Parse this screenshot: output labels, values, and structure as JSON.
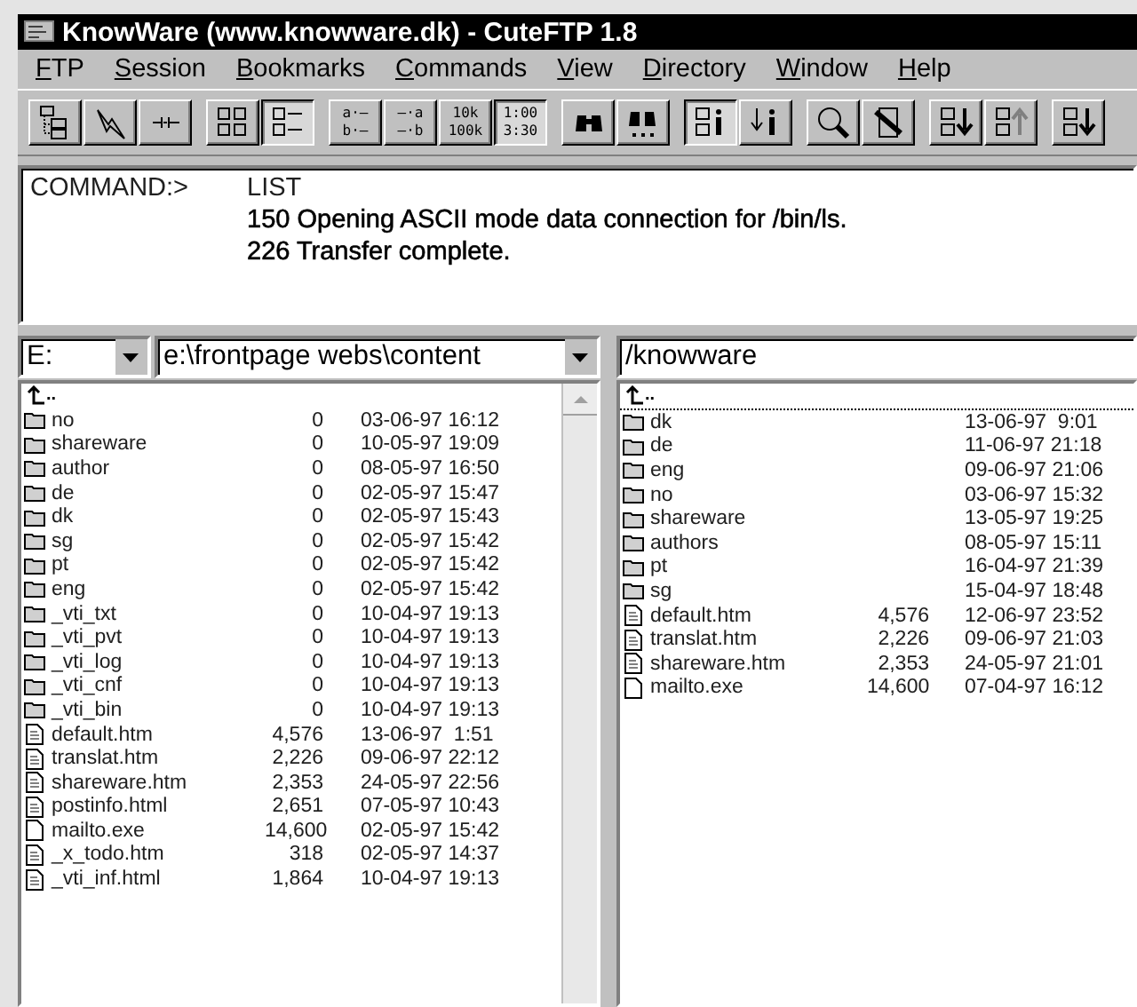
{
  "window": {
    "title": "KnowWare (www.knowware.dk) - CuteFTP 1.8"
  },
  "menu": [
    {
      "access_key": "F",
      "rest": "TP"
    },
    {
      "access_key": "S",
      "rest": "ession"
    },
    {
      "access_key": "B",
      "rest": "ookmarks"
    },
    {
      "access_key": "C",
      "rest": "ommands"
    },
    {
      "access_key": "V",
      "rest": "iew"
    },
    {
      "access_key": "D",
      "rest": "irectory"
    },
    {
      "access_key": "W",
      "rest": "indow"
    },
    {
      "access_key": "H",
      "rest": "elp"
    }
  ],
  "toolbar": [
    [
      {
        "kind": "tree",
        "pressed": false
      },
      {
        "kind": "bolt",
        "pressed": false
      },
      {
        "kind": "plug",
        "pressed": false
      }
    ],
    [
      {
        "kind": "large-icons",
        "pressed": false
      },
      {
        "kind": "details",
        "pressed": true
      }
    ],
    [
      {
        "kind": "text",
        "pressed": false,
        "lines": [
          "a·—",
          "b·—"
        ]
      },
      {
        "kind": "text",
        "pressed": false,
        "lines": [
          "—·a",
          "—·b"
        ]
      },
      {
        "kind": "text",
        "pressed": false,
        "lines": [
          "10k",
          "100k"
        ]
      },
      {
        "kind": "text",
        "pressed": true,
        "lines": [
          "1:00",
          "3:30"
        ]
      }
    ],
    [
      {
        "kind": "binoculars",
        "pressed": false
      },
      {
        "kind": "binoculars-next",
        "pressed": false
      }
    ],
    [
      {
        "kind": "info",
        "pressed": true
      },
      {
        "kind": "info-down",
        "pressed": false
      }
    ],
    [
      {
        "kind": "search",
        "pressed": false
      },
      {
        "kind": "cancel",
        "pressed": false
      }
    ],
    [
      {
        "kind": "download",
        "pressed": false
      },
      {
        "kind": "upload",
        "pressed": false
      }
    ],
    [
      {
        "kind": "download",
        "pressed": false
      }
    ]
  ],
  "log": [
    {
      "kind": "command",
      "prefix": "COMMAND:>",
      "text": "LIST"
    },
    {
      "kind": "response",
      "text": "150 Opening ASCII mode data connection for /bin/ls."
    },
    {
      "kind": "response",
      "text": "226 Transfer complete."
    }
  ],
  "local": {
    "drive": "E:",
    "path": "e:\\frontpage webs\\content",
    "parent_label": "..",
    "files": [
      {
        "kind": "folder",
        "name": "no",
        "size": "0",
        "date": "03-06-97 16:12"
      },
      {
        "kind": "folder",
        "name": "shareware",
        "size": "0",
        "date": "10-05-97 19:09"
      },
      {
        "kind": "folder",
        "name": "author",
        "size": "0",
        "date": "08-05-97 16:50"
      },
      {
        "kind": "folder",
        "name": "de",
        "size": "0",
        "date": "02-05-97 15:47"
      },
      {
        "kind": "folder",
        "name": "dk",
        "size": "0",
        "date": "02-05-97 15:43"
      },
      {
        "kind": "folder",
        "name": "sg",
        "size": "0",
        "date": "02-05-97 15:42"
      },
      {
        "kind": "folder",
        "name": "pt",
        "size": "0",
        "date": "02-05-97 15:42"
      },
      {
        "kind": "folder",
        "name": "eng",
        "size": "0",
        "date": "02-05-97 15:42"
      },
      {
        "kind": "folder",
        "name": "_vti_txt",
        "size": "0",
        "date": "10-04-97 19:13"
      },
      {
        "kind": "folder",
        "name": "_vti_pvt",
        "size": "0",
        "date": "10-04-97 19:13"
      },
      {
        "kind": "folder",
        "name": "_vti_log",
        "size": "0",
        "date": "10-04-97 19:13"
      },
      {
        "kind": "folder",
        "name": "_vti_cnf",
        "size": "0",
        "date": "10-04-97 19:13"
      },
      {
        "kind": "folder",
        "name": "_vti_bin",
        "size": "0",
        "date": "10-04-97 19:13"
      },
      {
        "kind": "document",
        "name": "default.htm",
        "size": "4,576",
        "date": "13-06-97  1:51"
      },
      {
        "kind": "document",
        "name": "translat.htm",
        "size": "2,226",
        "date": "09-06-97 22:12"
      },
      {
        "kind": "document",
        "name": "shareware.htm",
        "size": "2,353",
        "date": "24-05-97 22:56"
      },
      {
        "kind": "document",
        "name": "postinfo.html",
        "size": "2,651",
        "date": "07-05-97 10:43"
      },
      {
        "kind": "blank",
        "name": "mailto.exe",
        "size": "14,600",
        "date": "02-05-97 15:42"
      },
      {
        "kind": "document",
        "name": "_x_todo.htm",
        "size": "318",
        "date": "02-05-97 14:37"
      },
      {
        "kind": "document",
        "name": "_vti_inf.html",
        "size": "1,864",
        "date": "10-04-97 19:13"
      }
    ]
  },
  "remote": {
    "path": "/knowware",
    "parent_label": "..",
    "files": [
      {
        "kind": "folder",
        "name": "dk",
        "date": "13-06-97  9:01"
      },
      {
        "kind": "folder",
        "name": "de",
        "date": "11-06-97 21:18"
      },
      {
        "kind": "folder",
        "name": "eng",
        "date": "09-06-97 21:06"
      },
      {
        "kind": "folder",
        "name": "no",
        "date": "03-06-97 15:32"
      },
      {
        "kind": "folder",
        "name": "shareware",
        "date": "13-05-97 19:25"
      },
      {
        "kind": "folder",
        "name": "authors",
        "date": "08-05-97 15:11"
      },
      {
        "kind": "folder",
        "name": "pt",
        "date": "16-04-97 21:39"
      },
      {
        "kind": "folder",
        "name": "sg",
        "date": "15-04-97 18:48"
      },
      {
        "kind": "document",
        "name": "default.htm",
        "size": "4,576",
        "date": "12-06-97 23:52"
      },
      {
        "kind": "document",
        "name": "translat.htm",
        "size": "2,226",
        "date": "09-06-97 21:03"
      },
      {
        "kind": "document",
        "name": "shareware.htm",
        "size": "2,353",
        "date": "24-05-97 21:01"
      },
      {
        "kind": "blank",
        "name": "mailto.exe",
        "size": "14,600",
        "date": "07-04-97 16:12"
      }
    ]
  }
}
